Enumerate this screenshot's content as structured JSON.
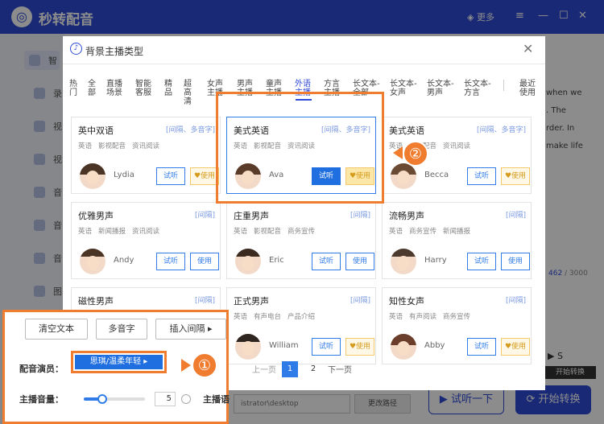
{
  "app": {
    "title": "秒转配音",
    "more_label": "更多",
    "logo_icon": "app-logo-icon"
  },
  "colors": {
    "brand": "#2f4bd8",
    "accent": "#2f7be8",
    "highlight": "#f07d2f",
    "vip": "#f2c96b"
  },
  "sidebar": {
    "items": [
      {
        "label": "智",
        "icon": "smart-icon"
      },
      {
        "label": "录",
        "icon": "record-icon"
      },
      {
        "label": "视",
        "icon": "video-icon"
      },
      {
        "label": "视",
        "icon": "video-icon"
      },
      {
        "label": "音",
        "icon": "audio-icon"
      },
      {
        "label": "音",
        "icon": "audio-icon"
      },
      {
        "label": "音",
        "icon": "audio-icon"
      },
      {
        "label": "图",
        "icon": "image-icon"
      }
    ]
  },
  "background": {
    "text_lines": [
      "when we",
      ". The",
      "rder. In",
      "make life"
    ],
    "count_current": "462",
    "count_total": "/ 3000",
    "path_value": "istrator\\desktop",
    "change_path_label": "更改路径",
    "try_label": "试听一下",
    "start_label": "开始转换",
    "start_tip": "开始转换",
    "right_label": "S"
  },
  "modal": {
    "title": "背景主播类型",
    "tabs": [
      {
        "label": "热门"
      },
      {
        "label": "全部"
      },
      {
        "label": "直播场景"
      },
      {
        "label": "智能客服"
      },
      {
        "label": "精品"
      },
      {
        "label": "超高清"
      },
      {
        "label": "女声主播"
      },
      {
        "label": "男声主播"
      },
      {
        "label": "童声主播"
      },
      {
        "label": "外语主播",
        "active": true
      },
      {
        "label": "方言主播"
      },
      {
        "label": "长文本-全部"
      },
      {
        "label": "长文本-女声"
      },
      {
        "label": "长文本-男声"
      },
      {
        "label": "长文本-方言"
      },
      {
        "label": "最近使用"
      }
    ],
    "cards": [
      {
        "name": "英中双语",
        "tag": "[间隔、多音字]",
        "meta": [
          "英语",
          "影视配音",
          "资讯阅读"
        ],
        "voice": "Lydia",
        "listen": "试听",
        "use": "使用",
        "vip": true
      },
      {
        "name": "美式英语",
        "tag": "[间隔、多音字]",
        "meta": [
          "英语",
          "影视配音",
          "资讯阅读"
        ],
        "voice": "Ava",
        "listen": "试听",
        "use": "使用",
        "vip": true,
        "selected": true
      },
      {
        "name": "美式英语",
        "tag": "[间隔、多音字]",
        "meta": [
          "英语",
          "影视配音",
          "资讯阅读"
        ],
        "voice": "Becca",
        "listen": "试听",
        "use": "使用",
        "vip": true
      },
      {
        "name": "优雅男声",
        "tag": "[间隔]",
        "meta": [
          "英语",
          "新闻播报",
          "资讯阅读"
        ],
        "voice": "Andy",
        "listen": "试听",
        "use": "使用",
        "vip": false
      },
      {
        "name": "庄重男声",
        "tag": "[间隔]",
        "meta": [
          "英语",
          "影视配音",
          "商务宣传"
        ],
        "voice": "Eric",
        "listen": "试听",
        "use": "使用",
        "vip": false
      },
      {
        "name": "流畅男声",
        "tag": "[间隔]",
        "meta": [
          "英语",
          "商务宣传",
          "新闻播报"
        ],
        "voice": "Harry",
        "listen": "试听",
        "use": "使用",
        "vip": false
      },
      {
        "name": "磁性男声",
        "tag": "[间隔]",
        "meta": [],
        "voice": "",
        "listen": "",
        "use": "",
        "vip": false
      },
      {
        "name": "正式男声",
        "tag": "[间隔]",
        "meta": [
          "英语",
          "有声电台",
          "产品介绍"
        ],
        "voice": "William",
        "listen": "试听",
        "use": "使用",
        "vip": true
      },
      {
        "name": "知性女声",
        "tag": "[间隔]",
        "meta": [
          "英语",
          "有声阅读",
          "商务宣传"
        ],
        "voice": "Abby",
        "listen": "试听",
        "use": "使用",
        "vip": true
      }
    ],
    "pager": {
      "prev": "上一页",
      "pages": [
        "1",
        "2"
      ],
      "current": "1",
      "next": "下一页"
    }
  },
  "inset": {
    "clear_label": "清空文本",
    "polyphone_label": "多音字",
    "insert_pause_label": "插入间隔",
    "actor_label": "配音演员：",
    "actor_value": "思琪/温柔年轻",
    "volume_label": "主播音量：",
    "volume_value": "5",
    "volume_level": 0.3,
    "speaker_label": "主播语"
  },
  "markers": {
    "m1": "①",
    "m2": "②"
  }
}
